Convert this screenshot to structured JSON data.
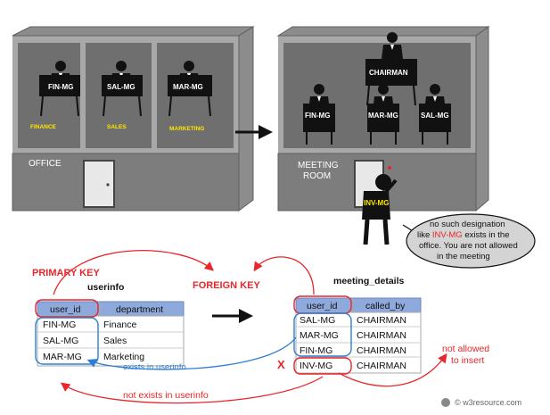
{
  "office": {
    "label": "OFFICE",
    "desks": [
      "FIN-MG",
      "SAL-MG",
      "MAR-MG"
    ],
    "sections": [
      "FINANCE",
      "SALES",
      "MARKETING"
    ]
  },
  "meeting_room": {
    "label_line1": "MEETING",
    "label_line2": "ROOM",
    "chairman": "CHAIRMAN",
    "seats": [
      "FIN-MG",
      "MAR-MG",
      "SAL-MG"
    ],
    "visitor": "INV-MG"
  },
  "bubble": {
    "line1": "no such designation",
    "line2_pre": "like ",
    "line2_highlight": "INV-MG",
    "line2_post": " exists in the",
    "line3": "office. You are not allowed",
    "line4": "in  the meeting"
  },
  "labels": {
    "primary_key": "PRIMARY KEY",
    "foreign_key": "FOREIGN KEY",
    "exists": "exists in userinfo",
    "not_exists": "not exists in userinfo",
    "not_allowed_1": "not allowed",
    "not_allowed_2": "to insert",
    "x_mark": "X"
  },
  "userinfo": {
    "title": "userinfo",
    "columns": [
      "user_id",
      "department"
    ],
    "rows": [
      [
        "FIN-MG",
        "Finance"
      ],
      [
        "SAL-MG",
        "Sales"
      ],
      [
        "MAR-MG",
        "Marketing"
      ]
    ]
  },
  "meeting_details": {
    "title": "meeting_details",
    "columns": [
      "user_id",
      "called_by"
    ],
    "rows": [
      [
        "SAL-MG",
        "CHAIRMAN"
      ],
      [
        "MAR-MG",
        "CHAIRMAN"
      ],
      [
        "FIN-MG",
        "CHAIRMAN"
      ],
      [
        "INV-MG",
        "CHAIRMAN"
      ]
    ]
  },
  "copyright": "© w3resource.com",
  "colors": {
    "red": "#e8262b",
    "blue": "#2f7fd0",
    "table_header": "#8ea9db"
  }
}
